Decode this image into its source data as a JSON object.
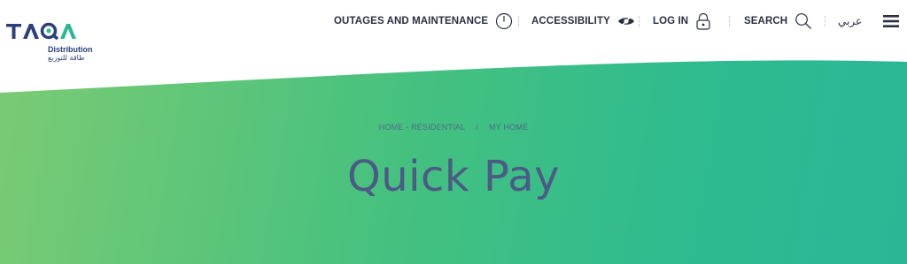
{
  "brand": {
    "wordmark": "TAQA",
    "sub_en": "Distribution",
    "sub_ar": "طاقة للتوزيع"
  },
  "nav": {
    "outages_label": "OUTAGES AND MAINTENANCE",
    "accessibility_label": "ACCESSIBILITY",
    "login_label": "LOG IN",
    "search_label": "SEARCH",
    "language_label": "عربي"
  },
  "breadcrumb": {
    "home": "HOME - RESIDENTIAL",
    "separator": "/",
    "current": "MY HOME"
  },
  "page": {
    "title": "Quick Pay"
  },
  "colors": {
    "brand_navy": "#2b3f7a",
    "brand_green": "#2ab796",
    "hero_start": "#7ccb73",
    "hero_end": "#2ab796"
  },
  "icons": {
    "outages": "power-icon",
    "accessibility": "eye-icon",
    "login": "lock-icon",
    "search": "search-icon",
    "menu": "hamburger-menu-icon"
  }
}
